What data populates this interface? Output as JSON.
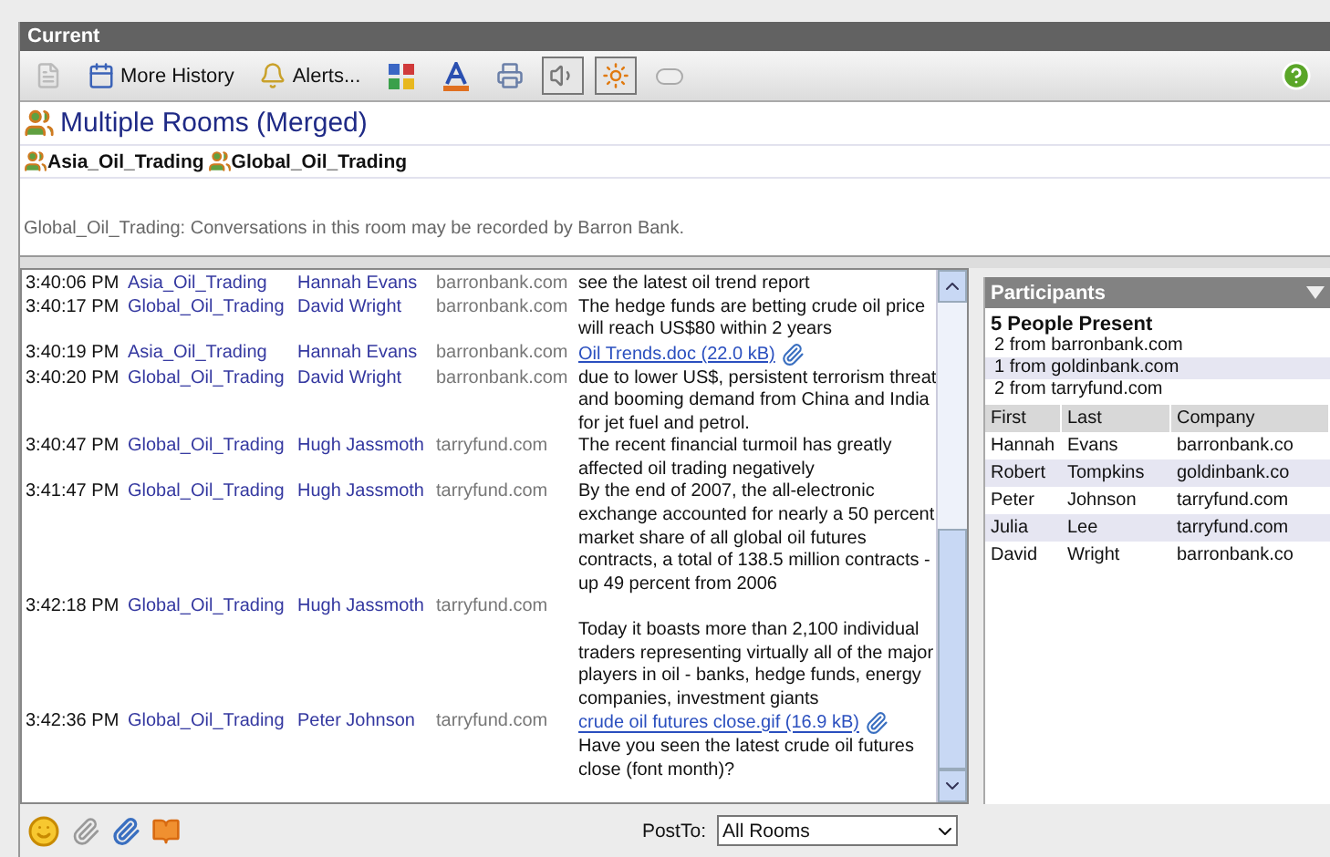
{
  "window": {
    "title": "Current"
  },
  "toolbar": [
    {
      "kind": "doc",
      "pressed": false
    },
    {
      "kind": "history",
      "label": "More History",
      "pressed": false
    },
    {
      "kind": "alerts",
      "label": "Alerts...",
      "pressed": false
    },
    {
      "kind": "grid",
      "pressed": false
    },
    {
      "kind": "font",
      "pressed": false
    },
    {
      "kind": "print",
      "pressed": false
    },
    {
      "kind": "sound",
      "pressed": true
    },
    {
      "kind": "flash",
      "pressed": true
    },
    {
      "kind": "pill",
      "pressed": false
    }
  ],
  "header": {
    "title": "Multiple Rooms (Merged)",
    "rooms": [
      "Asia_Oil_Trading",
      "Global_Oil_Trading"
    ],
    "notice": "Global_Oil_Trading: Conversations in this room may be recorded by Barron Bank."
  },
  "messages": [
    {
      "time": "3:40:06 PM",
      "room": "Asia_Oil_Trading",
      "user": "Hannah Evans",
      "domain": "barronbank.com",
      "text": "see the latest oil trend report"
    },
    {
      "time": "3:40:17 PM",
      "room": "Global_Oil_Trading",
      "user": "David Wright",
      "domain": "barronbank.com",
      "text": "The hedge funds are betting crude oil price will reach US$80 within 2 years"
    },
    {
      "time": "3:40:19 PM",
      "room": "Asia_Oil_Trading",
      "user": "Hannah Evans",
      "domain": "barronbank.com",
      "attachment": "Oil Trends.doc (22.0 kB)"
    },
    {
      "time": "3:40:20 PM",
      "room": "Global_Oil_Trading",
      "user": "David Wright",
      "domain": "barronbank.com",
      "text": "due to lower US$, persistent terrorism threat and booming demand from China and India for jet fuel and petrol."
    },
    {
      "time": "3:40:47 PM",
      "room": "Global_Oil_Trading",
      "user": "Hugh Jassmoth",
      "domain": "tarryfund.com",
      "text": "The recent financial turmoil has greatly affected oil trading negatively"
    },
    {
      "time": "3:41:47 PM",
      "room": "Global_Oil_Trading",
      "user": "Hugh Jassmoth",
      "domain": "tarryfund.com",
      "text": "By the end of 2007, the all-electronic exchange accounted for nearly a 50 percent market share of all global oil futures contracts, a total of 138.5 million contracts - up 49 percent from 2006"
    },
    {
      "time": "3:42:18 PM",
      "room": "Global_Oil_Trading",
      "user": "Hugh Jassmoth",
      "domain": "tarryfund.com",
      "text": "\nToday it boasts more than 2,100 individual traders representing virtually all of the major players in oil - banks, hedge funds, energy companies, investment giants"
    },
    {
      "time": "3:42:36 PM",
      "room": "Global_Oil_Trading",
      "user": "Peter Johnson",
      "domain": "tarryfund.com",
      "attachment": "crude oil futures close.gif (16.9 kB)",
      "text": "Have you seen the latest crude oil futures close (font month)?"
    }
  ],
  "compose": {
    "tools": [
      {
        "kind": "smiley",
        "disabled": false
      },
      {
        "kind": "clip",
        "disabled": true
      },
      {
        "kind": "clip",
        "disabled": false
      },
      {
        "kind": "book",
        "disabled": false
      }
    ],
    "post_to_label": "PostTo:",
    "post_to_value": "All Rooms"
  },
  "participants": {
    "title": "Participants",
    "summary": "5 People Present",
    "groups": [
      "2 from barronbank.com",
      "1 from goldinbank.com",
      "2 from tarryfund.com"
    ],
    "columns": [
      "First",
      "Last",
      "Company"
    ],
    "rows": [
      [
        "Hannah",
        "Evans",
        "barronbank.co"
      ],
      [
        "Robert",
        "Tompkins",
        "goldinbank.co"
      ],
      [
        "Peter",
        "Johnson",
        "tarryfund.com"
      ],
      [
        "Julia",
        "Lee",
        "tarryfund.com"
      ],
      [
        "David",
        "Wright",
        "barronbank.co"
      ]
    ]
  }
}
